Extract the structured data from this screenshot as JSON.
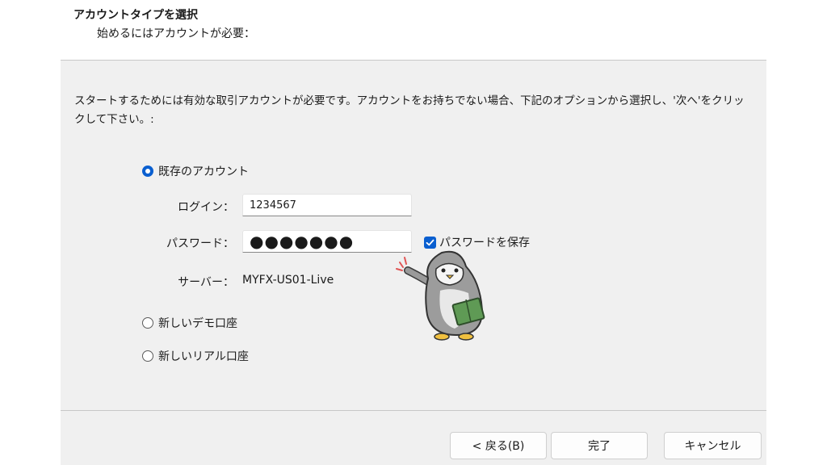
{
  "header": {
    "title": "アカウントタイプを選択",
    "subtitle": "始めるにはアカウントが必要："
  },
  "description": "スタートするためには有効な取引アカウントが必要です。アカウントをお持ちでない場合、下記のオプションから選択し、'次へ'をクリックして下さい。:",
  "options": {
    "existing_account": "既存のアカウント",
    "new_demo": "新しいデモ口座",
    "new_real": "新しいリアル口座"
  },
  "form": {
    "login_label": "ログイン：",
    "login_value": "1234567",
    "password_label": "パスワード：",
    "password_value": "●●●●●●●",
    "save_password_label": "パスワードを保存",
    "server_label": "サーバー：",
    "server_value": "MYFX-US01-Live"
  },
  "buttons": {
    "back": "< 戻る(B)",
    "finish": "完了",
    "cancel": "キャンセル"
  },
  "colors": {
    "accent": "#0a5fd0",
    "panel": "#f0f0f0",
    "header": "#ffffff"
  }
}
